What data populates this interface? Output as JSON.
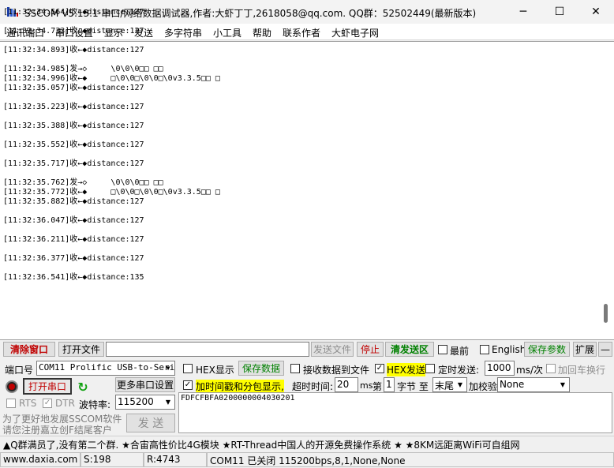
{
  "window": {
    "title": "SSCOM V5.13.1 串口/网络数据调试器,作者:大虾丁丁,2618058@qq.com. QQ群：52502449(最新版本)",
    "minimize": "─",
    "maximize": "☐",
    "close": "✕"
  },
  "menu": [
    "通讯端口",
    "串口设置",
    "显示",
    "发送",
    "多字符串",
    "小工具",
    "帮助",
    "联系作者",
    "大虾电子网"
  ],
  "log": {
    "lines": [
      "[11:32:34.564]收←◆distance:127",
      "",
      "[11:32:34.733]收←◆distance:127",
      "",
      "[11:32:34.893]收←◆distance:127",
      "",
      "[11:32:34.985]发→◇     \\0\\0\\0□□ □□",
      "[11:32:34.996]收←◆     □\\0\\0□\\0\\0□\\0v3.3.5□□ □",
      "[11:32:35.057]收←◆distance:127",
      "",
      "[11:32:35.223]收←◆distance:127",
      "",
      "[11:32:35.388]收←◆distance:127",
      "",
      "[11:32:35.552]收←◆distance:127",
      "",
      "[11:32:35.717]收←◆distance:127",
      "",
      "[11:32:35.762]发→◇     \\0\\0\\0□□ □□",
      "[11:32:35.772]收←◆     □\\0\\0□\\0\\0□\\0v3.3.5□□ □",
      "[11:32:35.882]收←◆distance:127",
      "",
      "[11:32:36.047]收←◆distance:127",
      "",
      "[11:32:36.211]收←◆distance:127",
      "",
      "[11:32:36.377]收←◆distance:127",
      "",
      "[11:32:36.541]收←◆distance:135"
    ]
  },
  "toolbar": {
    "clear": "清除窗口",
    "open_file": "打开文件",
    "file_path": "",
    "send_file": "发送文件",
    "stop": "停止",
    "clear_send": "清发送区",
    "topmost": "最前",
    "english": "English",
    "save_params": "保存参数",
    "expand": "扩展",
    "collapse": "—"
  },
  "settings": {
    "port_label": "端口号",
    "port_value": "COM11 Prolific USB-to-Seri",
    "hex_display": "HEX显示",
    "save_data": "保存数据",
    "recv_to_file": "接收数据到文件",
    "hex_send": "HEX发送",
    "timed_send": "定时发送:",
    "interval": "1000",
    "interval_unit": "ms/次",
    "add_crlf": "加回车换行",
    "open_port": "打开串口",
    "more_settings": "更多串口设置",
    "timestamp": "加时间戳和分包显示,",
    "timeout_label": "超时时间:",
    "timeout": "20",
    "timeout_unit": "ms",
    "byte_prefix": "第",
    "byte_index": "1",
    "byte_label": "字节 至",
    "byte_end": "末尾",
    "checksum_label": "加校验",
    "checksum": "None",
    "rts": "RTS",
    "dtr": "DTR",
    "baud_label": "波特率:",
    "baud": "115200",
    "send_text": "FDFCFBFA0200000004030201",
    "promo1": "为了更好地发展SSCOM软件",
    "promo2": "请您注册嘉立创F结尾客户",
    "send": "发 送"
  },
  "ticker": "▲Q群满员了,没有第二个群. ★合宙高性价比4G模块 ★RT-Thread中国人的开源免费操作系统 ★ ★8KM远距离WiFi可自组网",
  "status": {
    "site": "www.daxia.com",
    "sent": "S:198",
    "recv": "R:4743",
    "port": "COM11 已关闭  115200bps,8,1,None,None"
  }
}
